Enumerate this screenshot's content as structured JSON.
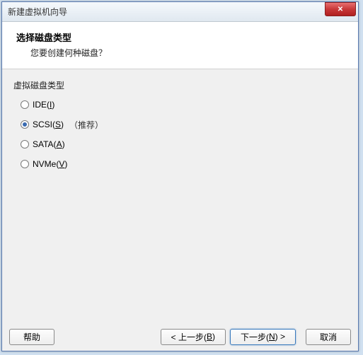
{
  "window": {
    "title": "新建虚拟机向导"
  },
  "header": {
    "title": "选择磁盘类型",
    "subtitle": "您要创建何种磁盘？"
  },
  "group": {
    "label": "虚拟磁盘类型"
  },
  "options": {
    "ide": {
      "prefix": "IDE(",
      "mnemonic": "I",
      "suffix": ")"
    },
    "scsi": {
      "prefix": "SCSI(",
      "mnemonic": "S",
      "suffix": ")",
      "recommended": "（推荐）"
    },
    "sata": {
      "prefix": "SATA(",
      "mnemonic": "A",
      "suffix": ")"
    },
    "nvme": {
      "prefix": "NVMe(",
      "mnemonic": "V",
      "suffix": ")"
    }
  },
  "buttons": {
    "help": "帮助",
    "back_prefix": "< 上一步(",
    "back_mnemonic": "B",
    "back_suffix": ")",
    "next_prefix": "下一步(",
    "next_mnemonic": "N",
    "next_suffix": ") >",
    "cancel": "取消"
  }
}
